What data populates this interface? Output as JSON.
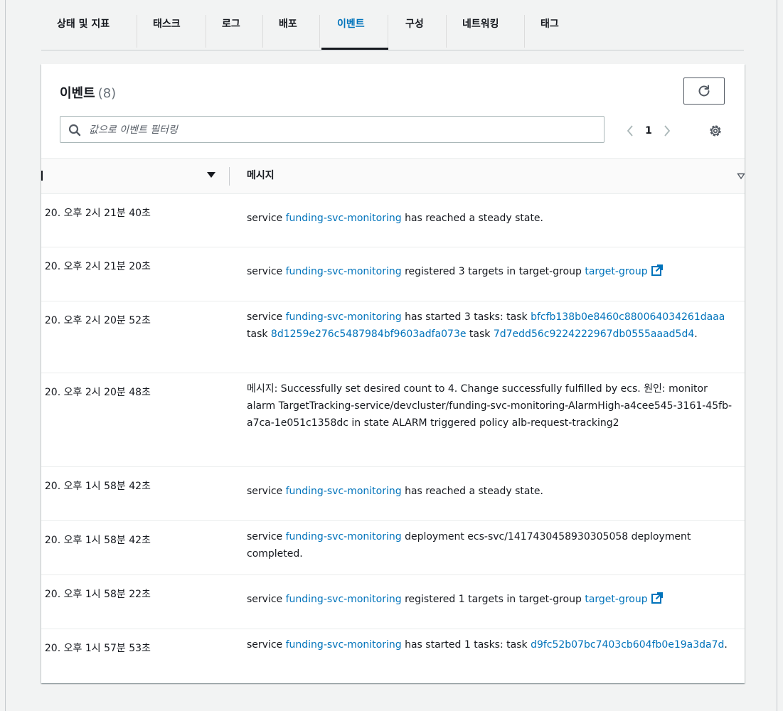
{
  "tabs": [
    {
      "label": "상태 및 지표",
      "active": false
    },
    {
      "label": "태스크",
      "active": false
    },
    {
      "label": "로그",
      "active": false
    },
    {
      "label": "배포",
      "active": false
    },
    {
      "label": "이벤트",
      "active": true
    },
    {
      "label": "구성",
      "active": false
    },
    {
      "label": "네트워킹",
      "active": false
    },
    {
      "label": "태그",
      "active": false
    }
  ],
  "panel": {
    "title": "이벤트",
    "count": "(8)",
    "search_placeholder": "값으로 이벤트 필터링",
    "current_page": "1"
  },
  "table": {
    "columns": [
      "메시지"
    ],
    "rows": [
      {
        "time": ". 20. 오후 2시 21분 40초",
        "parts": [
          {
            "t": "service "
          },
          {
            "t": "funding-svc-monitoring",
            "link": true
          },
          {
            "t": " has reached a steady state."
          }
        ]
      },
      {
        "time": ". 20. 오후 2시 21분 20초",
        "parts": [
          {
            "t": "service "
          },
          {
            "t": "funding-svc-monitoring",
            "link": true
          },
          {
            "t": " registered 3 targets in target-group "
          },
          {
            "t": "target-group",
            "link": true,
            "external": true
          }
        ]
      },
      {
        "time": ". 20. 오후 2시 20분 52초",
        "parts": [
          {
            "t": "service "
          },
          {
            "t": "funding-svc-monitoring",
            "link": true
          },
          {
            "t": " has started 3 tasks: task "
          },
          {
            "t": "bfcfb138b0e8460c880064034261daaa",
            "link": true
          },
          {
            "t": " task "
          },
          {
            "t": "8d1259e276c5487984bf9603adfa073e",
            "link": true
          },
          {
            "t": " task "
          },
          {
            "t": "7d7edd56c9224222967db0555aaad5d4",
            "link": true
          },
          {
            "t": "."
          }
        ]
      },
      {
        "time": ". 20. 오후 2시 20분 48초",
        "parts": [
          {
            "t": "메시지: Successfully set desired count to 4. Change successfully fulfilled by ecs. 원인: monitor alarm TargetTracking-service/devcluster/funding-svc-monitoring-AlarmHigh-a4cee545-3161-45fb-a7ca-1e051c1358dc in state ALARM triggered policy alb-request-tracking2"
          }
        ]
      },
      {
        "time": ". 20. 오후 1시 58분 42초",
        "parts": [
          {
            "t": "service "
          },
          {
            "t": "funding-svc-monitoring",
            "link": true
          },
          {
            "t": " has reached a steady state."
          }
        ]
      },
      {
        "time": ". 20. 오후 1시 58분 42초",
        "parts": [
          {
            "t": "service "
          },
          {
            "t": "funding-svc-monitoring",
            "link": true
          },
          {
            "t": " deployment ecs-svc/1417430458930305058 deployment completed."
          }
        ]
      },
      {
        "time": ". 20. 오후 1시 58분 22초",
        "parts": [
          {
            "t": "service "
          },
          {
            "t": "funding-svc-monitoring",
            "link": true
          },
          {
            "t": " registered 1 targets in target-group "
          },
          {
            "t": "target-group",
            "link": true,
            "external": true
          }
        ]
      },
      {
        "time": ". 20. 오후 1시 57분 53초",
        "parts": [
          {
            "t": "service "
          },
          {
            "t": "funding-svc-monitoring",
            "link": true
          },
          {
            "t": " has started 1 tasks: task "
          },
          {
            "t": "d9fc52b07bc7403cb604fb0e19a3da7d",
            "link": true
          },
          {
            "t": "."
          }
        ]
      }
    ]
  },
  "colors": {
    "link": "#0073bb",
    "text": "#16191f",
    "background": "#f2f3f3"
  },
  "icons": [
    "search-icon",
    "refresh-icon",
    "chevron-left-icon",
    "chevron-right-icon",
    "settings-icon",
    "sort-desc-icon",
    "sort-icon",
    "external-link-icon"
  ]
}
